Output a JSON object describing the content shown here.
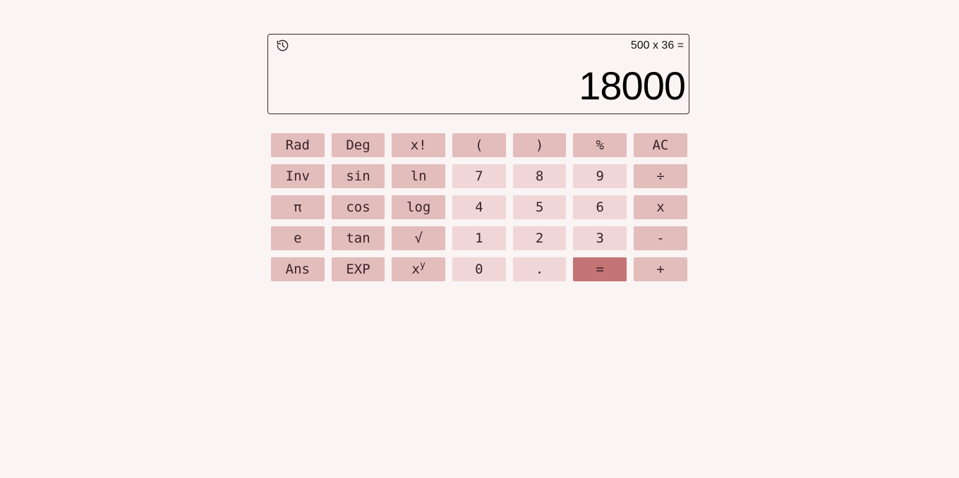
{
  "display": {
    "history_icon": "history-icon",
    "expression": "500 x 36 =",
    "result": "18000"
  },
  "colors": {
    "page_background": "#faf4f4",
    "function_key": "#e3bcbc",
    "number_key": "#f0d6d6",
    "equals_key": "#c47474",
    "key_text": "#3a2329",
    "display_border": "#3a2329"
  },
  "keypad": {
    "rad": "Rad",
    "deg": "Deg",
    "factorial": "x!",
    "open_paren": "(",
    "close_paren": ")",
    "percent": "%",
    "clear": "AC",
    "inv": "Inv",
    "sin": "sin",
    "ln": "ln",
    "seven": "7",
    "eight": "8",
    "nine": "9",
    "divide": "÷",
    "pi": "π",
    "cos": "cos",
    "log": "log",
    "four": "4",
    "five": "5",
    "six": "6",
    "multiply": "x",
    "e": "e",
    "tan": "tan",
    "sqrt": "√",
    "one": "1",
    "two": "2",
    "three": "3",
    "subtract": "-",
    "ans": "Ans",
    "exp": "EXP",
    "power_base": "x",
    "power_exp": "y",
    "zero": "0",
    "decimal": ".",
    "equals": "=",
    "add": "+"
  }
}
